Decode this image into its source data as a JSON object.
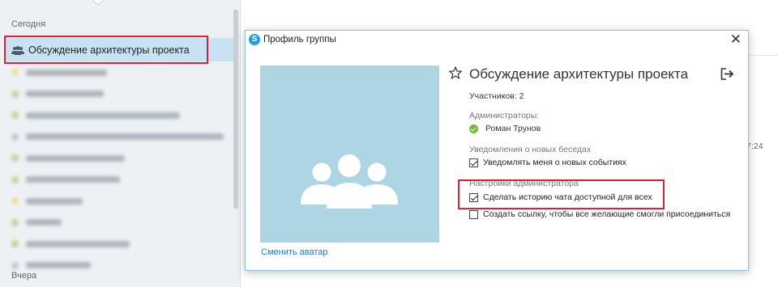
{
  "sidebar": {
    "today_label": "Сегодня",
    "yesterday_label": "Вчера",
    "selected_chat": "Обсуждение архитектуры проекта",
    "blurred_items": [
      {
        "color": "#f2cf52",
        "width": 100
      },
      {
        "color": "#8dc04a",
        "width": 96
      },
      {
        "color": "#8dc04a",
        "width": 190
      },
      {
        "color": "#9aa3ad",
        "width": 244
      },
      {
        "color": "#8dc04a",
        "width": 122
      },
      {
        "color": "#8dc04a",
        "width": 116
      },
      {
        "color": "#f2cf52",
        "width": 70
      },
      {
        "color": "#8dc04a",
        "width": 44
      },
      {
        "color": "#8dc04a",
        "width": 128
      },
      {
        "color": "#9aa3ad",
        "width": 80
      }
    ]
  },
  "right_pane": {
    "partial_time": "7:24"
  },
  "dialog": {
    "title": "Профиль группы",
    "group_name": "Обсуждение архитектуры проекта",
    "members": "Участников: 2",
    "admins_header": "Администраторы:",
    "admin_name": "Роман Трунов",
    "notifications_header": "Уведомления о новых беседах",
    "notify_label": "Уведомлять меня о новых событиях",
    "admin_settings_header": "Настройки администратора",
    "history_label": "Сделать историю чата доступной для всех",
    "link_label": "Создать ссылку, чтобы все желающие смогли присоединиться",
    "change_avatar": "Сменить аватар",
    "close_glyph": "✕"
  },
  "colors": {
    "accent": "#1a7ad0",
    "highlight": "#e0203b",
    "avatar_bg": "#add5e3",
    "online": "#77b63b"
  }
}
